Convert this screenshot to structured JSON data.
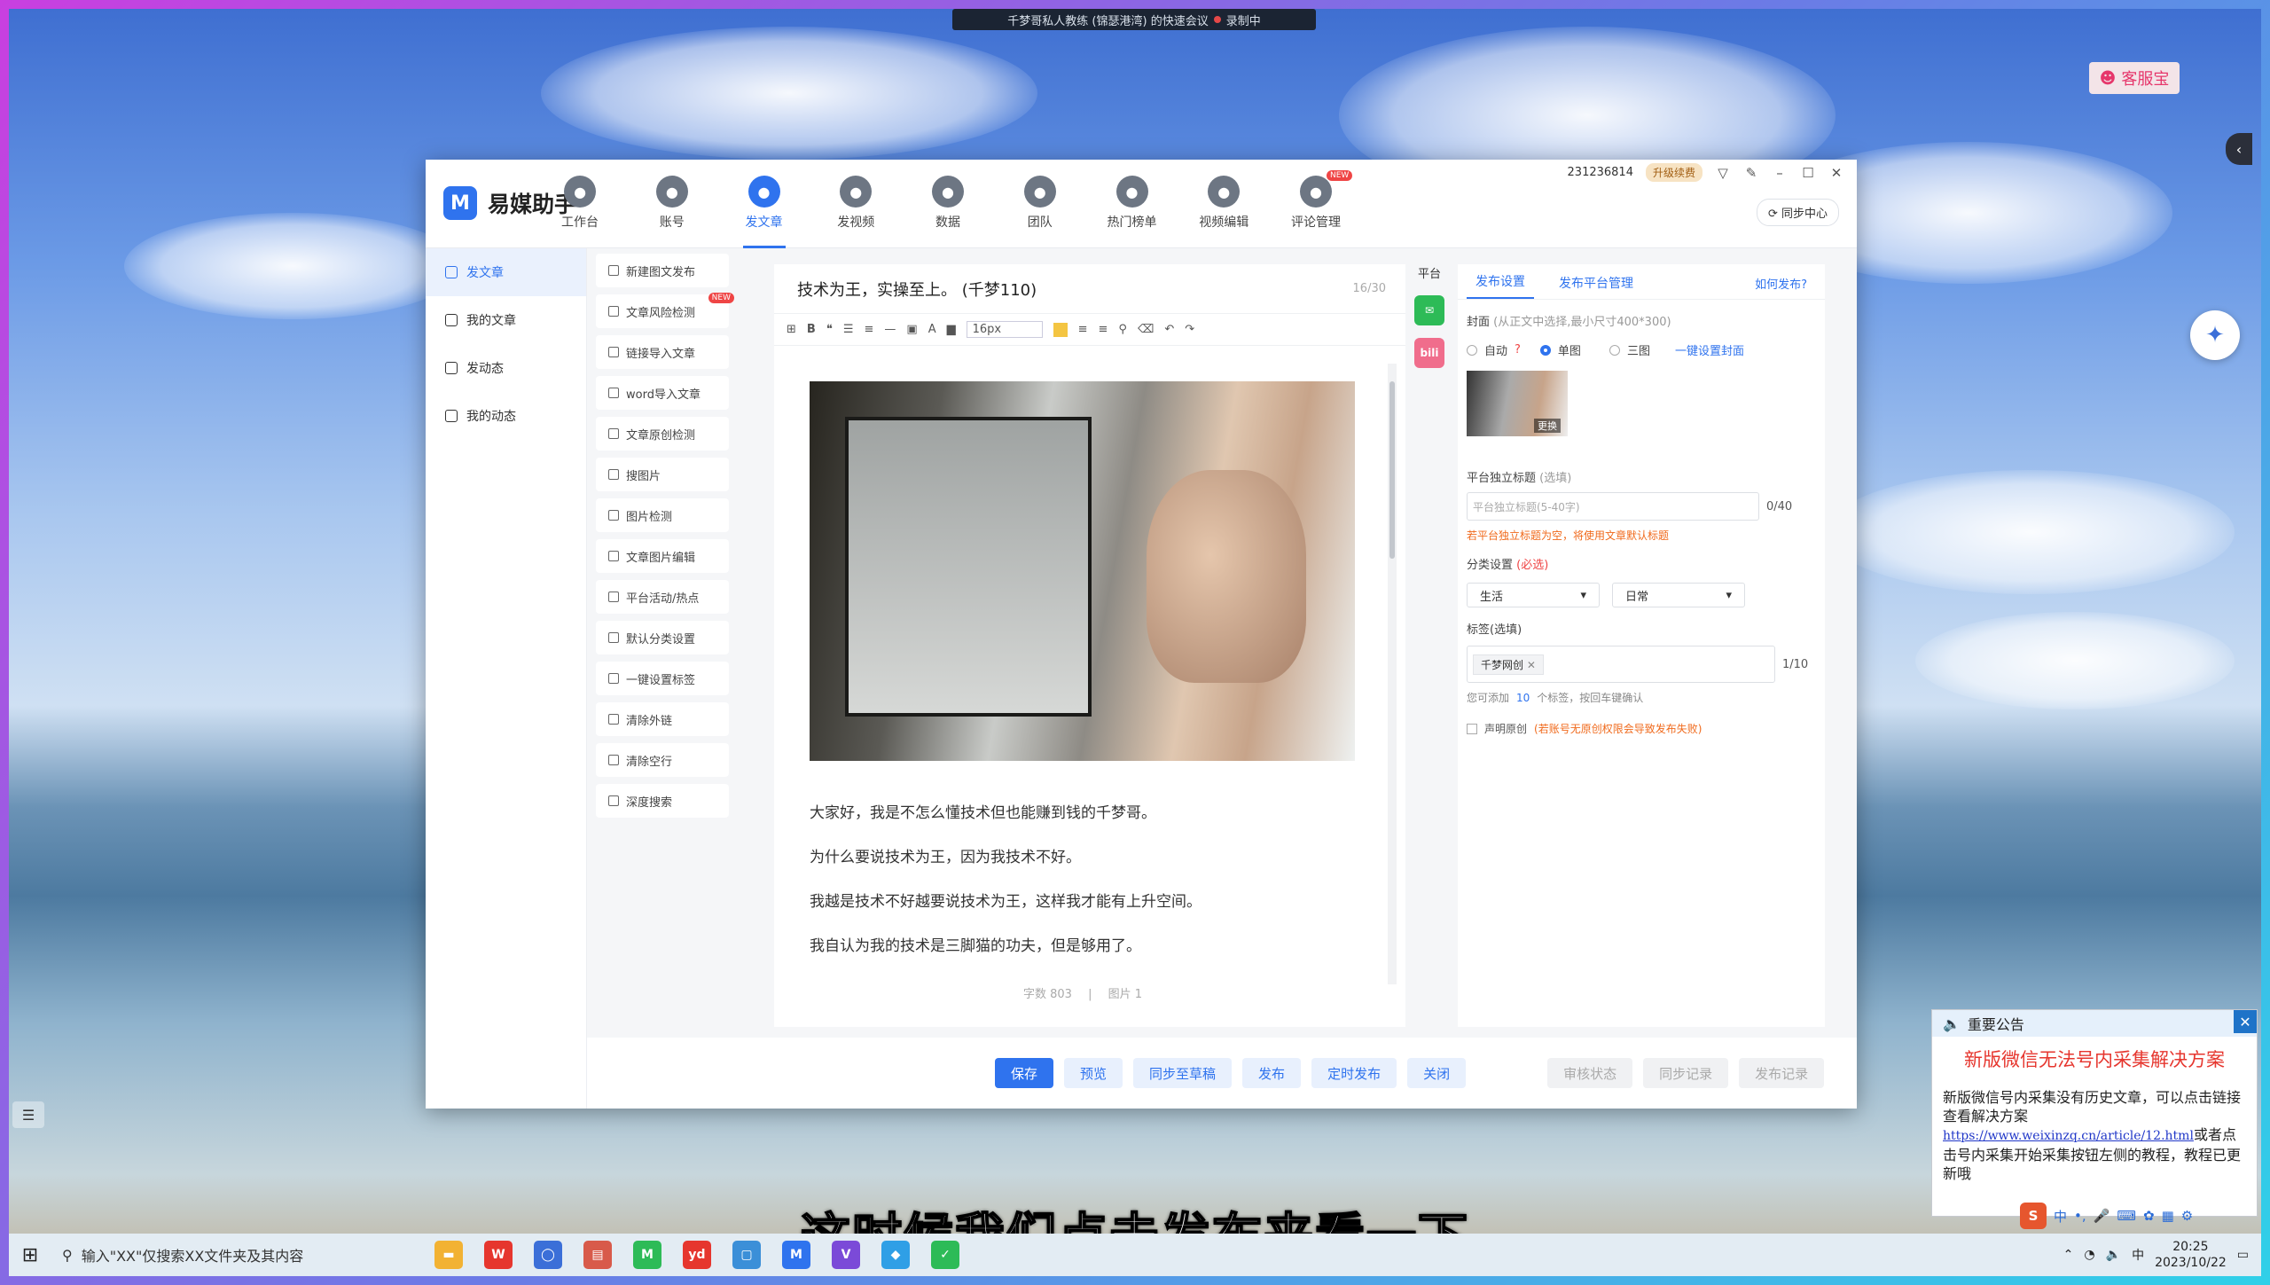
{
  "rec_bar": {
    "text": "千梦哥私人教练 (锦瑟港湾) 的快速会议",
    "status": "录制中"
  },
  "desktop": {
    "kefu": "客服宝"
  },
  "app": {
    "name": "易媒助手",
    "nav": [
      {
        "label": "工作台",
        "icon": "workbench-icon"
      },
      {
        "label": "账号",
        "icon": "account-icon"
      },
      {
        "label": "发文章",
        "icon": "article-icon",
        "active": true
      },
      {
        "label": "发视频",
        "icon": "video-icon"
      },
      {
        "label": "数据",
        "icon": "data-icon"
      },
      {
        "label": "团队",
        "icon": "team-icon"
      },
      {
        "label": "热门榜单",
        "icon": "hot-icon"
      },
      {
        "label": "视频编辑",
        "icon": "video-edit-icon"
      },
      {
        "label": "评论管理",
        "icon": "comment-icon",
        "badge": "NEW"
      }
    ],
    "account_id": "231236814",
    "upgrade": "升级续费",
    "sync_center": "同步中心",
    "sidebar": [
      "发文章",
      "我的文章",
      "发动态",
      "我的动态"
    ],
    "tools": [
      {
        "label": "新建图文发布"
      },
      {
        "label": "文章风险检测",
        "badge": "NEW"
      },
      {
        "label": "链接导入文章"
      },
      {
        "label": "word导入文章"
      },
      {
        "label": "文章原创检测"
      },
      {
        "label": "搜图片"
      },
      {
        "label": "图片检测"
      },
      {
        "label": "文章图片编辑"
      },
      {
        "label": "平台活动/热点"
      },
      {
        "label": "默认分类设置"
      },
      {
        "label": "一键设置标签"
      },
      {
        "label": "清除外链"
      },
      {
        "label": "清除空行"
      },
      {
        "label": "深度搜索"
      }
    ],
    "editor": {
      "title": "技术为王，实操至上。 (千梦110)",
      "title_count": "16/30",
      "font_size": "16px",
      "paragraphs": [
        "大家好，我是不怎么懂技术但也能赚到钱的千梦哥。",
        "为什么要说技术为王，因为我技术不好。",
        "我越是技术不好越要说技术为王，这样我才能有上升空间。",
        "我自认为我的技术是三脚猫的功夫，但是够用了。"
      ],
      "word_count": "字数 803",
      "image_count": "图片 1"
    },
    "platform_label": "平台",
    "settings": {
      "tabs": [
        "发布设置",
        "发布平台管理"
      ],
      "how": "如何发布?",
      "cover_label": "封面",
      "cover_hint": "(从正文中选择,最小尺寸400*300)",
      "cover_options": [
        "自动",
        "单图",
        "三图"
      ],
      "cover_selected": "单图",
      "cover_one_click": "一键设置封面",
      "cover_thumb_label": "更换",
      "title_label": "平台独立标题",
      "title_hint": "(选填)",
      "title_placeholder": "平台独立标题(5-40字)",
      "title_count": "0/40",
      "title_warn": "若平台独立标题为空，将使用文章默认标题",
      "category_label": "分类设置",
      "category_req": "(必选)",
      "category_1": "生活",
      "category_2": "日常",
      "tags_label": "标签(选填)",
      "tag": "千梦网创",
      "tags_count": "1/10",
      "tags_hint_pre": "您可添加",
      "tags_hint_num": "10",
      "tags_hint_post": "个标签，按回车键确认",
      "original_label": "声明原创",
      "original_warn": "(若账号无原创权限会导致发布失败)"
    },
    "bottom_buttons": [
      "保存",
      "预览",
      "同步至草稿",
      "发布",
      "定时发布",
      "关闭"
    ],
    "bottom_gray": [
      "审核状态",
      "同步记录",
      "发布记录"
    ]
  },
  "notice": {
    "header": "重要公告",
    "title": "新版微信无法号内采集解决方案",
    "body1": "新版微信号内采集没有历史文章，可以点击链接查看解决方案",
    "link": "https://www.weixinzq.cn/article/12.html",
    "body2": "或者点击号内采集开始采集按钮左侧的教程，教程已更新哦"
  },
  "subtitle": "这时候我们点击发布来看一下",
  "taskbar": {
    "search": "输入\"XX\"仅搜索XX文件夹及其内容",
    "time": "20:25",
    "date": "2023/10/22"
  },
  "colors": {
    "brand": "#2f73ee",
    "danger": "#ef4545",
    "warn": "#f06a1c"
  }
}
